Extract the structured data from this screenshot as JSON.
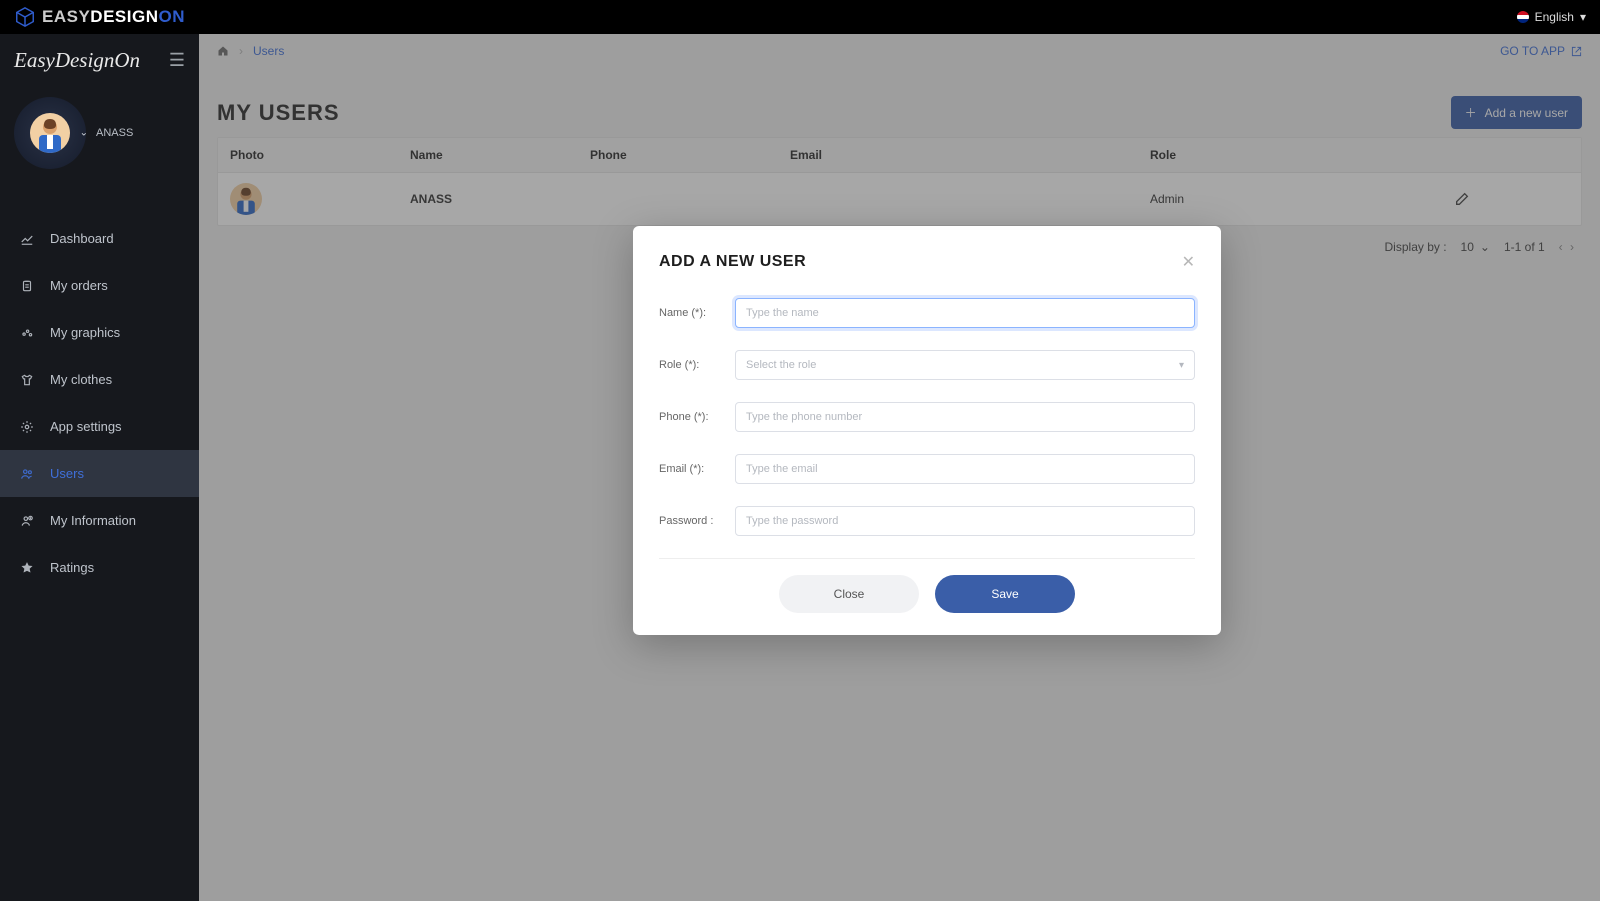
{
  "topbar": {
    "brand_part1": "EASY",
    "brand_part2": "DESIGN",
    "brand_part3": "ON",
    "language_label": "English"
  },
  "sidebar": {
    "logo_text": "EasyDesignOn",
    "username": "ANASS",
    "items": [
      {
        "label": "Dashboard",
        "icon": "chart-line-icon"
      },
      {
        "label": "My orders",
        "icon": "clipboard-icon"
      },
      {
        "label": "My graphics",
        "icon": "palette-icon"
      },
      {
        "label": "My clothes",
        "icon": "tshirt-icon"
      },
      {
        "label": "App settings",
        "icon": "gear-icon"
      },
      {
        "label": "Users",
        "icon": "users-icon"
      },
      {
        "label": "My Information",
        "icon": "user-info-icon"
      },
      {
        "label": "Ratings",
        "icon": "star-icon"
      }
    ],
    "active_index": 5
  },
  "breadcrumb": {
    "leaf": "Users"
  },
  "go_to_app_label": "GO TO APP",
  "page_title": "MY USERS",
  "add_user_button_label": "Add a new user",
  "table": {
    "headers": {
      "photo": "Photo",
      "name": "Name",
      "phone": "Phone",
      "email": "Email",
      "role": "Role"
    },
    "rows": [
      {
        "name": "ANASS",
        "phone": "",
        "email": "",
        "role": "Admin"
      }
    ]
  },
  "pager": {
    "display_by_label": "Display by :",
    "page_size": "10",
    "range_text": "1-1 of 1"
  },
  "modal": {
    "title": "ADD A NEW USER",
    "fields": {
      "name": {
        "label": "Name (*):",
        "placeholder": "Type the name"
      },
      "role": {
        "label": "Role (*):",
        "placeholder": "Select the role"
      },
      "phone": {
        "label": "Phone (*):",
        "placeholder": "Type the phone number"
      },
      "email": {
        "label": "Email (*):",
        "placeholder": "Type the email"
      },
      "password": {
        "label": "Password :",
        "placeholder": "Type the password"
      }
    },
    "close_label": "Close",
    "save_label": "Save"
  }
}
